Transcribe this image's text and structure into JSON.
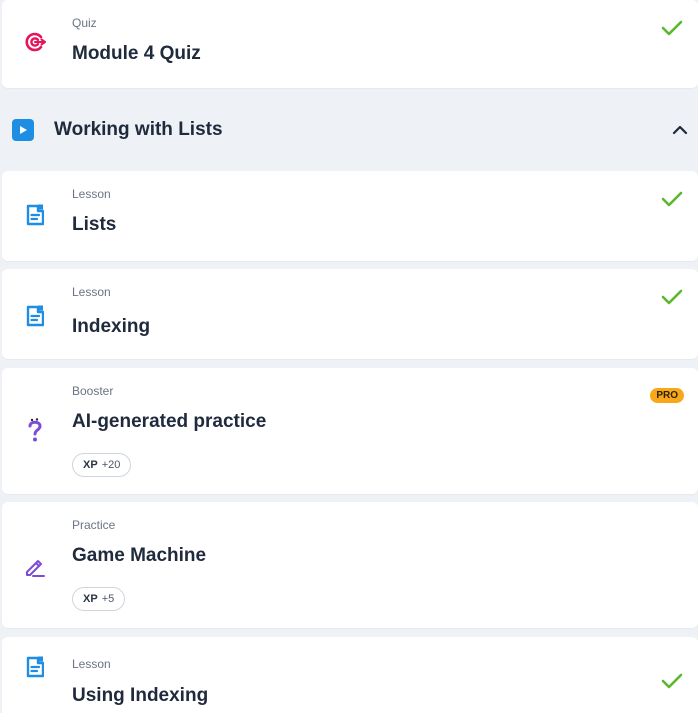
{
  "items_top": {
    "quiz": {
      "type": "Quiz",
      "title": "Module 4 Quiz",
      "completed": true
    }
  },
  "section": {
    "title": "Working with Lists",
    "expanded": true
  },
  "items": [
    {
      "type": "Lesson",
      "title": "Lists",
      "completed": true
    },
    {
      "type": "Lesson",
      "title": "Indexing",
      "completed": true
    },
    {
      "type": "Booster",
      "title": "AI-generated practice",
      "badge": "PRO",
      "xp_label": "XP",
      "xp_value": "+20"
    },
    {
      "type": "Practice",
      "title": "Game Machine",
      "xp_label": "XP",
      "xp_value": "+5"
    },
    {
      "type": "Lesson",
      "title": "Using Indexing",
      "completed": true
    }
  ],
  "colors": {
    "accent_blue": "#1e8de4",
    "check_green": "#5ab82d",
    "quiz_pink": "#e6145a",
    "practice_purple": "#7b4bd9",
    "pro_orange": "#f7a719"
  },
  "icons": {
    "quiz": "target-icon",
    "lesson": "document-icon",
    "booster": "question-mark-icon",
    "practice": "pencil-icon",
    "section": "play-icon",
    "collapse": "chevron-up-icon",
    "done": "checkmark-icon"
  }
}
